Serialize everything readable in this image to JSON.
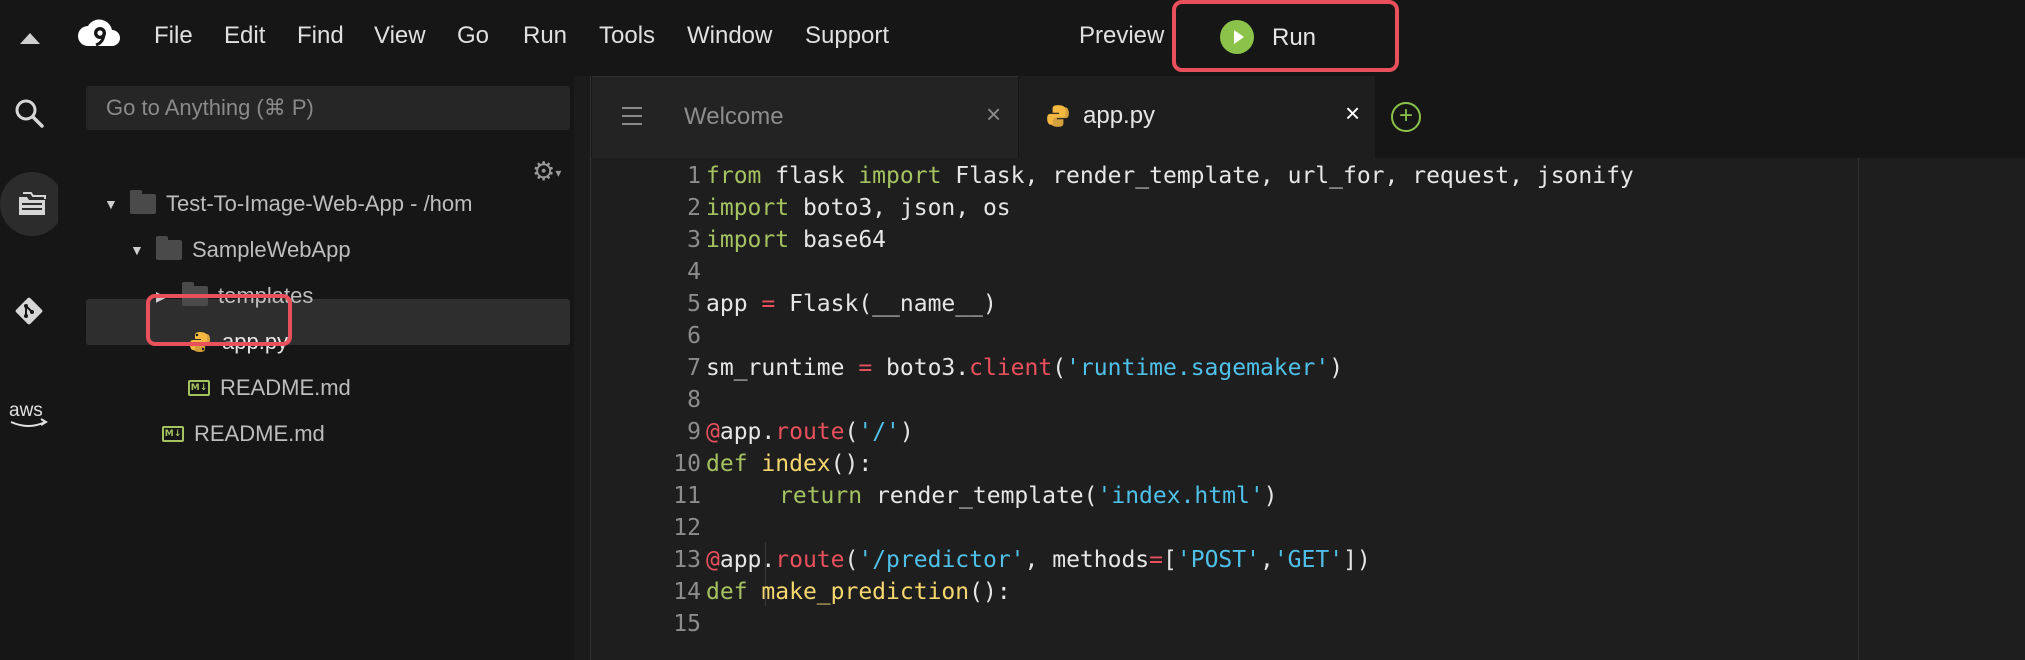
{
  "menubar": {
    "items": [
      "File",
      "Edit",
      "Find",
      "View",
      "Go",
      "Run",
      "Tools",
      "Window",
      "Support"
    ],
    "preview_label": "Preview",
    "run_label": "Run"
  },
  "sidebar": {
    "search_placeholder": "Go to Anything (⌘ P)",
    "tree": [
      {
        "label": "Test-To-Image-Web-App - /hom",
        "kind": "folder",
        "expanded": true
      },
      {
        "label": "SampleWebApp",
        "kind": "folder",
        "expanded": true
      },
      {
        "label": "templates",
        "kind": "folder",
        "expanded": false
      },
      {
        "label": "app.py",
        "kind": "python",
        "selected": true
      },
      {
        "label": "README.md",
        "kind": "markdown"
      },
      {
        "label": "README.md",
        "kind": "markdown"
      }
    ]
  },
  "editor": {
    "tabs": [
      {
        "label": "Welcome",
        "active": false
      },
      {
        "label": "app.py",
        "active": true
      }
    ],
    "lines": [
      {
        "n": "1"
      },
      {
        "n": "2"
      },
      {
        "n": "3"
      },
      {
        "n": "4"
      },
      {
        "n": "5"
      },
      {
        "n": "6"
      },
      {
        "n": "7"
      },
      {
        "n": "8"
      },
      {
        "n": "9"
      },
      {
        "n": "10"
      },
      {
        "n": "11"
      },
      {
        "n": "12"
      },
      {
        "n": "13"
      },
      {
        "n": "14"
      },
      {
        "n": "15"
      }
    ],
    "code": {
      "l1": {
        "a": "from",
        "b": " flask ",
        "c": "import",
        "d": " Flask, render_template, url_for, request, jsonify"
      },
      "l2": {
        "a": "import",
        "b": " boto3, json, os"
      },
      "l3": {
        "a": "import",
        "b": " base64"
      },
      "l5": {
        "a": "app ",
        "b": "=",
        "c": " Flask(__name__)"
      },
      "l7": {
        "a": "sm_runtime ",
        "b": "=",
        "c": " boto3.",
        "d": "client",
        "e": "(",
        "f": "'runtime.sagemaker'",
        "g": ")"
      },
      "l9": {
        "a": "@",
        "b": "app.",
        "c": "route",
        "d": "(",
        "e": "'/'",
        "f": ")"
      },
      "l10": {
        "a": "def",
        "b": " ",
        "c": "index",
        "d": "():"
      },
      "l11": {
        "a": "return",
        "b": " render_template(",
        "c": "'index.html'",
        "d": ")"
      },
      "l13": {
        "a": "@",
        "b": "app.",
        "c": "route",
        "d": "(",
        "e": "'/predictor'",
        "f": ", methods",
        "g": "=",
        "h": "[",
        "i": "'POST'",
        "j": ",",
        "k": "'GET'",
        "l": "])"
      },
      "l14": {
        "a": "def",
        "b": " ",
        "c": "make_prediction",
        "d": "():"
      }
    }
  },
  "colors": {
    "accent_red": "#e8505b",
    "run_green": "#8bc34a",
    "keyword": "#a5c261",
    "string": "#4fc1e9"
  }
}
